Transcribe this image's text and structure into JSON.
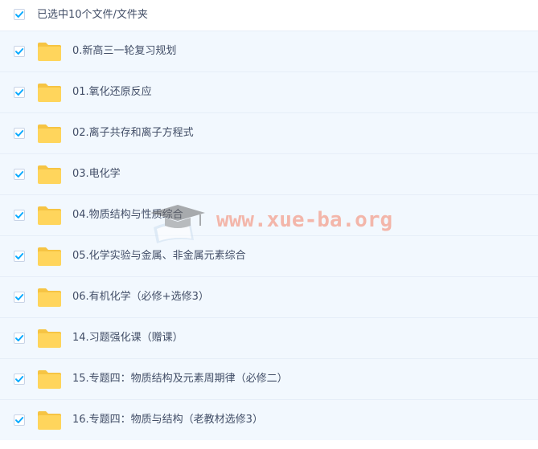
{
  "header": {
    "selection_label": "已选中10个文件/文件夹",
    "checked": true
  },
  "colors": {
    "folder": "#ffd55c",
    "folder_tab": "#f6c443",
    "check": "#09aaff",
    "row_bg": "#f2f8fe"
  },
  "icons": {
    "folder": "folder-icon",
    "check": "checkbox-checked-icon"
  },
  "items": [
    {
      "name": "0.新高三一轮复习规划"
    },
    {
      "name": "01.氧化还原反应"
    },
    {
      "name": "02.离子共存和离子方程式"
    },
    {
      "name": "03.电化学"
    },
    {
      "name": "04.物质结构与性质综合"
    },
    {
      "name": "05.化学实验与金属、非金属元素综合"
    },
    {
      "name": "06.有机化学（必修+选修3）"
    },
    {
      "name": "14.习题强化课（赠课）"
    },
    {
      "name": "15.专题四：物质结构及元素周期律（必修二）"
    },
    {
      "name": "16.专题四：物质与结构（老教材选修3）"
    }
  ],
  "watermark": {
    "text": "www.xue-ba.org"
  }
}
